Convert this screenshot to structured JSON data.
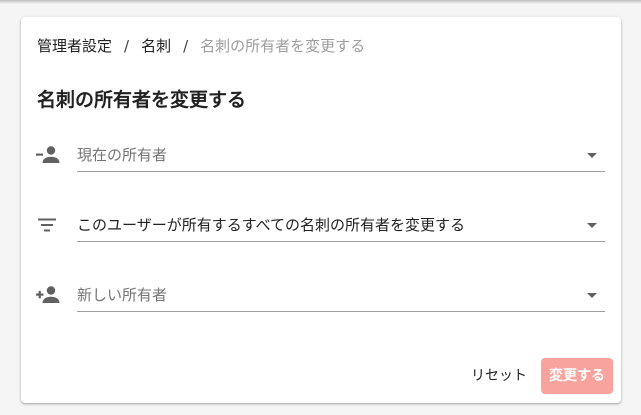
{
  "breadcrumb": {
    "items": [
      "管理者設定",
      "名刺"
    ],
    "separator": "/",
    "current": "名刺の所有者を変更する"
  },
  "page": {
    "title": "名刺の所有者を変更する"
  },
  "fields": {
    "current_owner": {
      "icon": "person-remove-icon",
      "placeholder": "現在の所有者",
      "value": ""
    },
    "scope": {
      "icon": "filter-list-icon",
      "value": "このユーザーが所有するすべての名刺の所有者を変更する"
    },
    "new_owner": {
      "icon": "person-add-icon",
      "placeholder": "新しい所有者",
      "value": ""
    }
  },
  "actions": {
    "reset_label": "リセット",
    "submit_label": "変更する"
  },
  "colors": {
    "submit_background": "#f8a39d",
    "icon": "#616161",
    "muted_text": "#9e9e9e"
  }
}
